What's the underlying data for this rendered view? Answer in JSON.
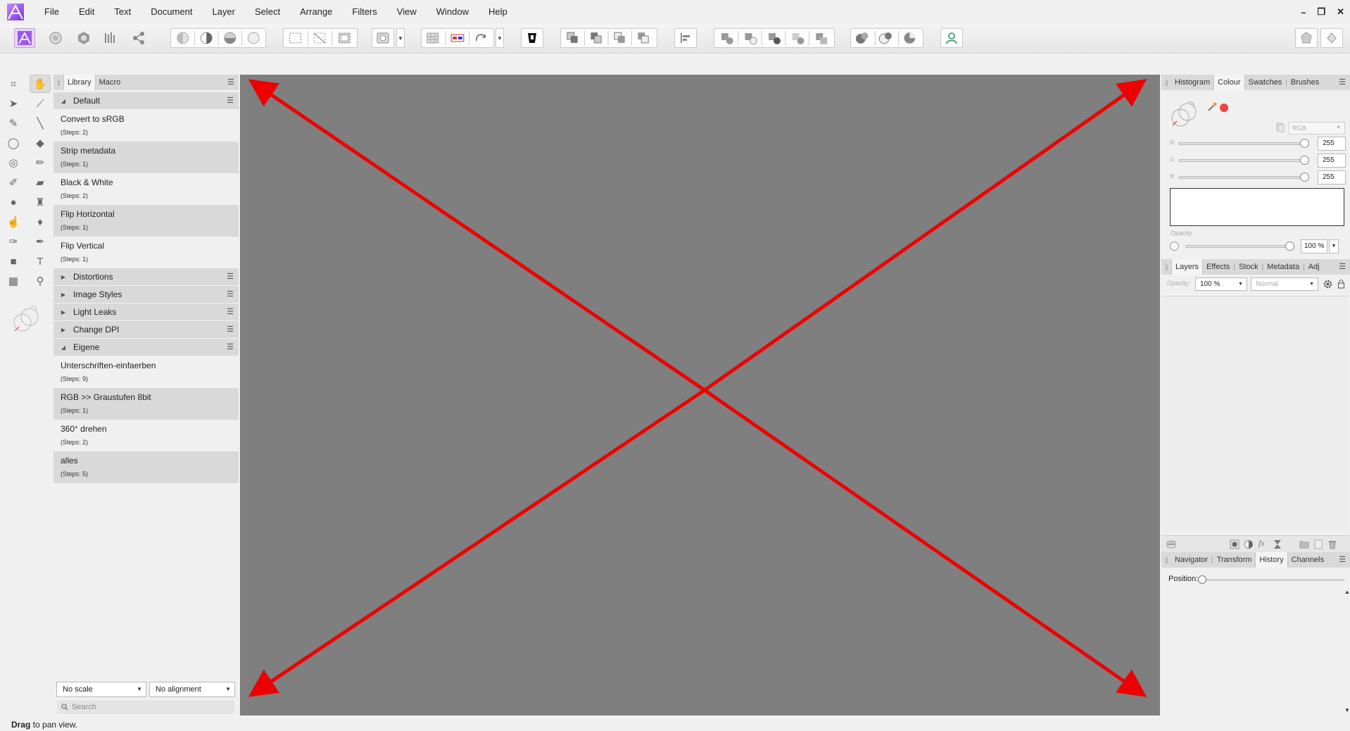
{
  "menu": [
    "File",
    "Edit",
    "Text",
    "Document",
    "Layer",
    "Select",
    "Arrange",
    "Filters",
    "View",
    "Window",
    "Help"
  ],
  "window_controls": {
    "minimize": "–",
    "restore": "❐",
    "close": "✕"
  },
  "library": {
    "tabs": [
      "Library",
      "Macro"
    ],
    "categories": [
      {
        "name": "Default",
        "expanded": true,
        "items": [
          {
            "name": "Convert to sRGB",
            "steps": "(Steps: 2)"
          },
          {
            "name": "Strip metadata",
            "steps": "(Steps: 1)"
          },
          {
            "name": "Black & White",
            "steps": "(Steps: 2)"
          },
          {
            "name": "Flip Horizontal",
            "steps": "(Steps: 1)"
          },
          {
            "name": "Flip Vertical",
            "steps": "(Steps: 1)"
          }
        ]
      },
      {
        "name": "Distortions",
        "expanded": false
      },
      {
        "name": "Image Styles",
        "expanded": false
      },
      {
        "name": "Light Leaks",
        "expanded": false
      },
      {
        "name": "Change DPI",
        "expanded": false
      },
      {
        "name": "Eigene",
        "expanded": true,
        "items": [
          {
            "name": "Unterschriften-einfaerben",
            "steps": "(Steps: 9)"
          },
          {
            "name": "RGB >> Graustufen 8bit",
            "steps": "(Steps: 1)"
          },
          {
            "name": "360° drehen",
            "steps": "(Steps: 2)"
          },
          {
            "name": "alles",
            "steps": "(Steps: 5)"
          }
        ]
      }
    ],
    "scale_select": "No scale",
    "alignment_select": "No alignment",
    "search_placeholder": "Search"
  },
  "colour_panel": {
    "tabs": [
      "Histogram",
      "Colour",
      "Swatches",
      "Brushes"
    ],
    "active_tab": "Colour",
    "model": "RGB",
    "channels": [
      {
        "label": "R:",
        "value": "255"
      },
      {
        "label": "G:",
        "value": "255"
      },
      {
        "label": "B:",
        "value": "255"
      }
    ],
    "opacity_label": "Opacity",
    "opacity_value": "100 %",
    "accent_color": "#ee4444"
  },
  "layers_panel": {
    "tabs": [
      "Layers",
      "Effects",
      "Stock",
      "Metadata",
      "Adj"
    ],
    "active_tab": "Layers",
    "opacity_label": "Opacity:",
    "opacity_value": "100 %",
    "blend_mode": "Normal"
  },
  "history_panel": {
    "tabs": [
      "Navigator",
      "Transform",
      "History",
      "Channels"
    ],
    "active_tab": "History",
    "position_label": "Position:",
    "position": 0
  },
  "status": {
    "bold": "Drag",
    "text": " to pan view."
  },
  "canvas": {
    "background": "#7f7f7f",
    "arrow_color": "#ee0000"
  }
}
